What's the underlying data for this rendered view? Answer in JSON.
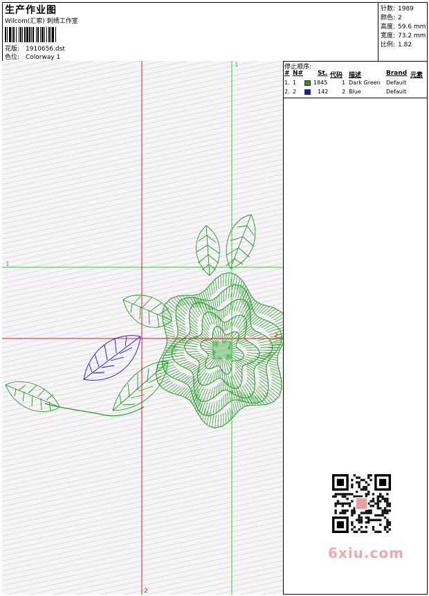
{
  "header": {
    "title": "生产作业图",
    "subtitle": "Wilcom(汇索) 刺绣工作室",
    "design_label": "花版:",
    "design_value": "1910656.dst",
    "colorway_label": "色位:",
    "colorway_value": "Colorway 1"
  },
  "stats": [
    {
      "label": "针数:",
      "value": "1989"
    },
    {
      "label": "颜色:",
      "value": "2"
    },
    {
      "label": "高度:",
      "value": "59.6 mm"
    },
    {
      "label": "宽度:",
      "value": "73.2 mm"
    },
    {
      "label": "比例:",
      "value": "1.82"
    }
  ],
  "guides": {
    "h_green_label": "1",
    "h_red_label": "2",
    "v_green_label": "1",
    "v_red_label": "2"
  },
  "stop_sequence": {
    "title": "停止顺序:",
    "headers": {
      "num": "#",
      "needle": "N#",
      "stitches": "St.",
      "code": "代码",
      "desc": "描述",
      "brand": "Brand",
      "element": "元素"
    },
    "rows": [
      {
        "num": "1.",
        "needle": "1",
        "stitches": "1845",
        "code": "1",
        "desc": "Dark Green",
        "brand": "Default",
        "color": "#1d9a1d"
      },
      {
        "num": "2.",
        "needle": "2",
        "stitches": "142",
        "code": "2",
        "desc": "Blue",
        "brand": "Default",
        "color": "#1010e8"
      }
    ]
  },
  "watermark": "6xiu.com",
  "colors": {
    "green": "#1d9a1d",
    "blue": "#1010e8",
    "guide_green": "#2ad12a",
    "guide_red": "#d81818"
  }
}
